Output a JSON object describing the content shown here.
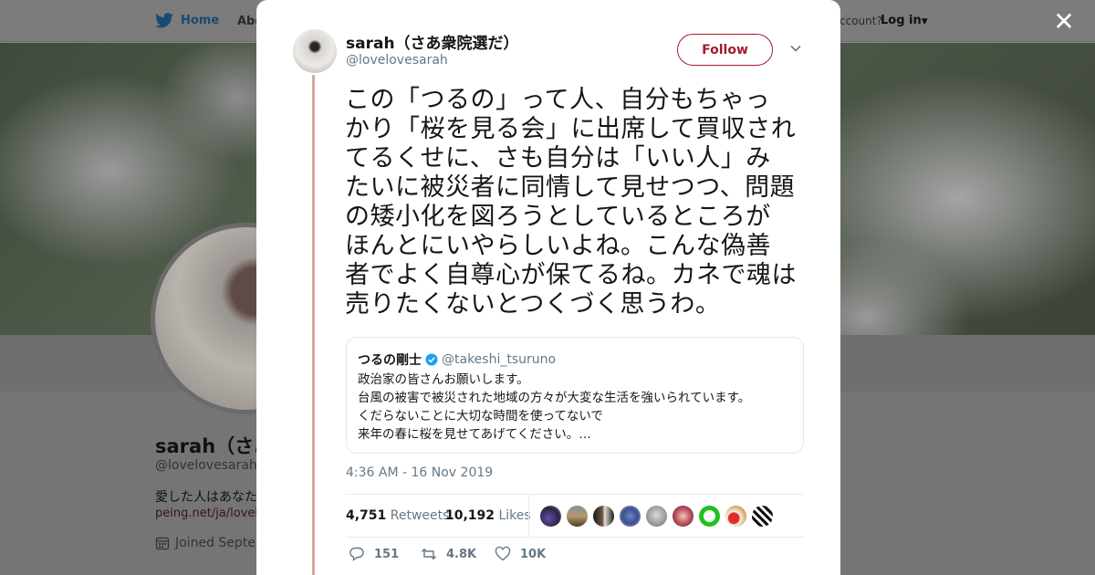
{
  "nav": {
    "home_label": "Home",
    "about_label": "Abo",
    "account_text": "ccount?",
    "login_label": "Log in"
  },
  "profile": {
    "name": "sarah（さあ",
    "handle": "@lovelovesarah",
    "bio": "愛した人はあなた",
    "link": "peing.net/ja/lovelo",
    "joined": "Joined Septen"
  },
  "modal": {
    "close_label": "✕",
    "author": {
      "name": "sarah（さあ衆院選だ）",
      "handle": "@lovelovesarah"
    },
    "follow_label": "Follow",
    "tweet_lines": [
      "この「つるの」って人、自分もちゃっ",
      "かり「桜を見る会」に出席して買収され",
      "てるくせに、さも自分は「いい人」み",
      "たいに被災者に同情して見せつつ、問題",
      "の矮小化を図ろうとしているところが",
      "ほんとにいやらしいよね。こんな偽善",
      "者でよく自尊心が保てるね。カネで魂は",
      "売りたくないとつくづく思うわ。"
    ],
    "quoted": {
      "name": "つるの剛士",
      "handle": "@takeshi_tsuruno",
      "lines": [
        "政治家の皆さんお願いします。",
        "台風の被害で被災された地域の方々が大変な生活を強いられています。",
        "くだらないことに大切な時間を使ってないで",
        "来年の春に桜を見せてあげてください。…"
      ]
    },
    "timestamp": "4:36 AM - 16 Nov 2019",
    "stats": {
      "retweets_count": "4,751",
      "retweets_label": "Retweets",
      "likes_count": "10,192",
      "likes_label": "Likes"
    },
    "actions": {
      "reply_count": "151",
      "retweet_count": "4.8K",
      "like_count": "10K"
    }
  },
  "colors": {
    "accent": "#a41c2a",
    "thread_line": "#d8a5a5",
    "twitter_blue": "#1da1f2",
    "muted_text": "#657786"
  }
}
